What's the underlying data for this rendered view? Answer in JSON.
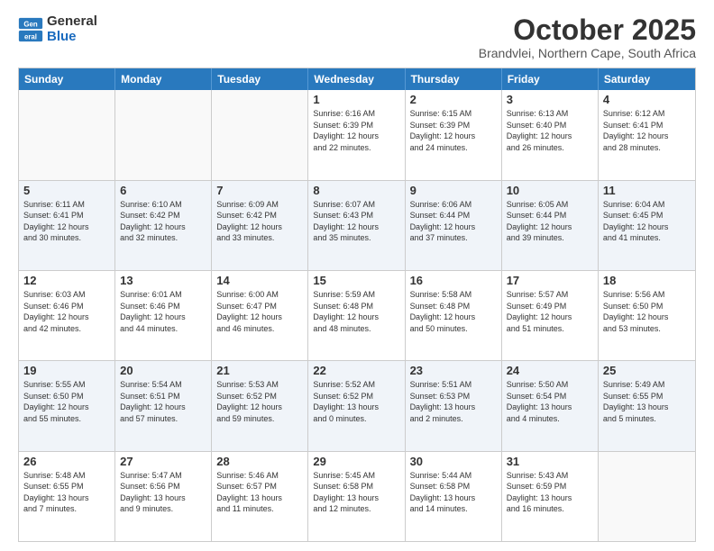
{
  "header": {
    "logo_general": "General",
    "logo_blue": "Blue",
    "month_title": "October 2025",
    "location": "Brandvlei, Northern Cape, South Africa"
  },
  "days": [
    "Sunday",
    "Monday",
    "Tuesday",
    "Wednesday",
    "Thursday",
    "Friday",
    "Saturday"
  ],
  "rows": [
    [
      {
        "date": "",
        "info": ""
      },
      {
        "date": "",
        "info": ""
      },
      {
        "date": "",
        "info": ""
      },
      {
        "date": "1",
        "info": "Sunrise: 6:16 AM\nSunset: 6:39 PM\nDaylight: 12 hours\nand 22 minutes."
      },
      {
        "date": "2",
        "info": "Sunrise: 6:15 AM\nSunset: 6:39 PM\nDaylight: 12 hours\nand 24 minutes."
      },
      {
        "date": "3",
        "info": "Sunrise: 6:13 AM\nSunset: 6:40 PM\nDaylight: 12 hours\nand 26 minutes."
      },
      {
        "date": "4",
        "info": "Sunrise: 6:12 AM\nSunset: 6:41 PM\nDaylight: 12 hours\nand 28 minutes."
      }
    ],
    [
      {
        "date": "5",
        "info": "Sunrise: 6:11 AM\nSunset: 6:41 PM\nDaylight: 12 hours\nand 30 minutes."
      },
      {
        "date": "6",
        "info": "Sunrise: 6:10 AM\nSunset: 6:42 PM\nDaylight: 12 hours\nand 32 minutes."
      },
      {
        "date": "7",
        "info": "Sunrise: 6:09 AM\nSunset: 6:42 PM\nDaylight: 12 hours\nand 33 minutes."
      },
      {
        "date": "8",
        "info": "Sunrise: 6:07 AM\nSunset: 6:43 PM\nDaylight: 12 hours\nand 35 minutes."
      },
      {
        "date": "9",
        "info": "Sunrise: 6:06 AM\nSunset: 6:44 PM\nDaylight: 12 hours\nand 37 minutes."
      },
      {
        "date": "10",
        "info": "Sunrise: 6:05 AM\nSunset: 6:44 PM\nDaylight: 12 hours\nand 39 minutes."
      },
      {
        "date": "11",
        "info": "Sunrise: 6:04 AM\nSunset: 6:45 PM\nDaylight: 12 hours\nand 41 minutes."
      }
    ],
    [
      {
        "date": "12",
        "info": "Sunrise: 6:03 AM\nSunset: 6:46 PM\nDaylight: 12 hours\nand 42 minutes."
      },
      {
        "date": "13",
        "info": "Sunrise: 6:01 AM\nSunset: 6:46 PM\nDaylight: 12 hours\nand 44 minutes."
      },
      {
        "date": "14",
        "info": "Sunrise: 6:00 AM\nSunset: 6:47 PM\nDaylight: 12 hours\nand 46 minutes."
      },
      {
        "date": "15",
        "info": "Sunrise: 5:59 AM\nSunset: 6:48 PM\nDaylight: 12 hours\nand 48 minutes."
      },
      {
        "date": "16",
        "info": "Sunrise: 5:58 AM\nSunset: 6:48 PM\nDaylight: 12 hours\nand 50 minutes."
      },
      {
        "date": "17",
        "info": "Sunrise: 5:57 AM\nSunset: 6:49 PM\nDaylight: 12 hours\nand 51 minutes."
      },
      {
        "date": "18",
        "info": "Sunrise: 5:56 AM\nSunset: 6:50 PM\nDaylight: 12 hours\nand 53 minutes."
      }
    ],
    [
      {
        "date": "19",
        "info": "Sunrise: 5:55 AM\nSunset: 6:50 PM\nDaylight: 12 hours\nand 55 minutes."
      },
      {
        "date": "20",
        "info": "Sunrise: 5:54 AM\nSunset: 6:51 PM\nDaylight: 12 hours\nand 57 minutes."
      },
      {
        "date": "21",
        "info": "Sunrise: 5:53 AM\nSunset: 6:52 PM\nDaylight: 12 hours\nand 59 minutes."
      },
      {
        "date": "22",
        "info": "Sunrise: 5:52 AM\nSunset: 6:52 PM\nDaylight: 13 hours\nand 0 minutes."
      },
      {
        "date": "23",
        "info": "Sunrise: 5:51 AM\nSunset: 6:53 PM\nDaylight: 13 hours\nand 2 minutes."
      },
      {
        "date": "24",
        "info": "Sunrise: 5:50 AM\nSunset: 6:54 PM\nDaylight: 13 hours\nand 4 minutes."
      },
      {
        "date": "25",
        "info": "Sunrise: 5:49 AM\nSunset: 6:55 PM\nDaylight: 13 hours\nand 5 minutes."
      }
    ],
    [
      {
        "date": "26",
        "info": "Sunrise: 5:48 AM\nSunset: 6:55 PM\nDaylight: 13 hours\nand 7 minutes."
      },
      {
        "date": "27",
        "info": "Sunrise: 5:47 AM\nSunset: 6:56 PM\nDaylight: 13 hours\nand 9 minutes."
      },
      {
        "date": "28",
        "info": "Sunrise: 5:46 AM\nSunset: 6:57 PM\nDaylight: 13 hours\nand 11 minutes."
      },
      {
        "date": "29",
        "info": "Sunrise: 5:45 AM\nSunset: 6:58 PM\nDaylight: 13 hours\nand 12 minutes."
      },
      {
        "date": "30",
        "info": "Sunrise: 5:44 AM\nSunset: 6:58 PM\nDaylight: 13 hours\nand 14 minutes."
      },
      {
        "date": "31",
        "info": "Sunrise: 5:43 AM\nSunset: 6:59 PM\nDaylight: 13 hours\nand 16 minutes."
      },
      {
        "date": "",
        "info": ""
      }
    ]
  ]
}
